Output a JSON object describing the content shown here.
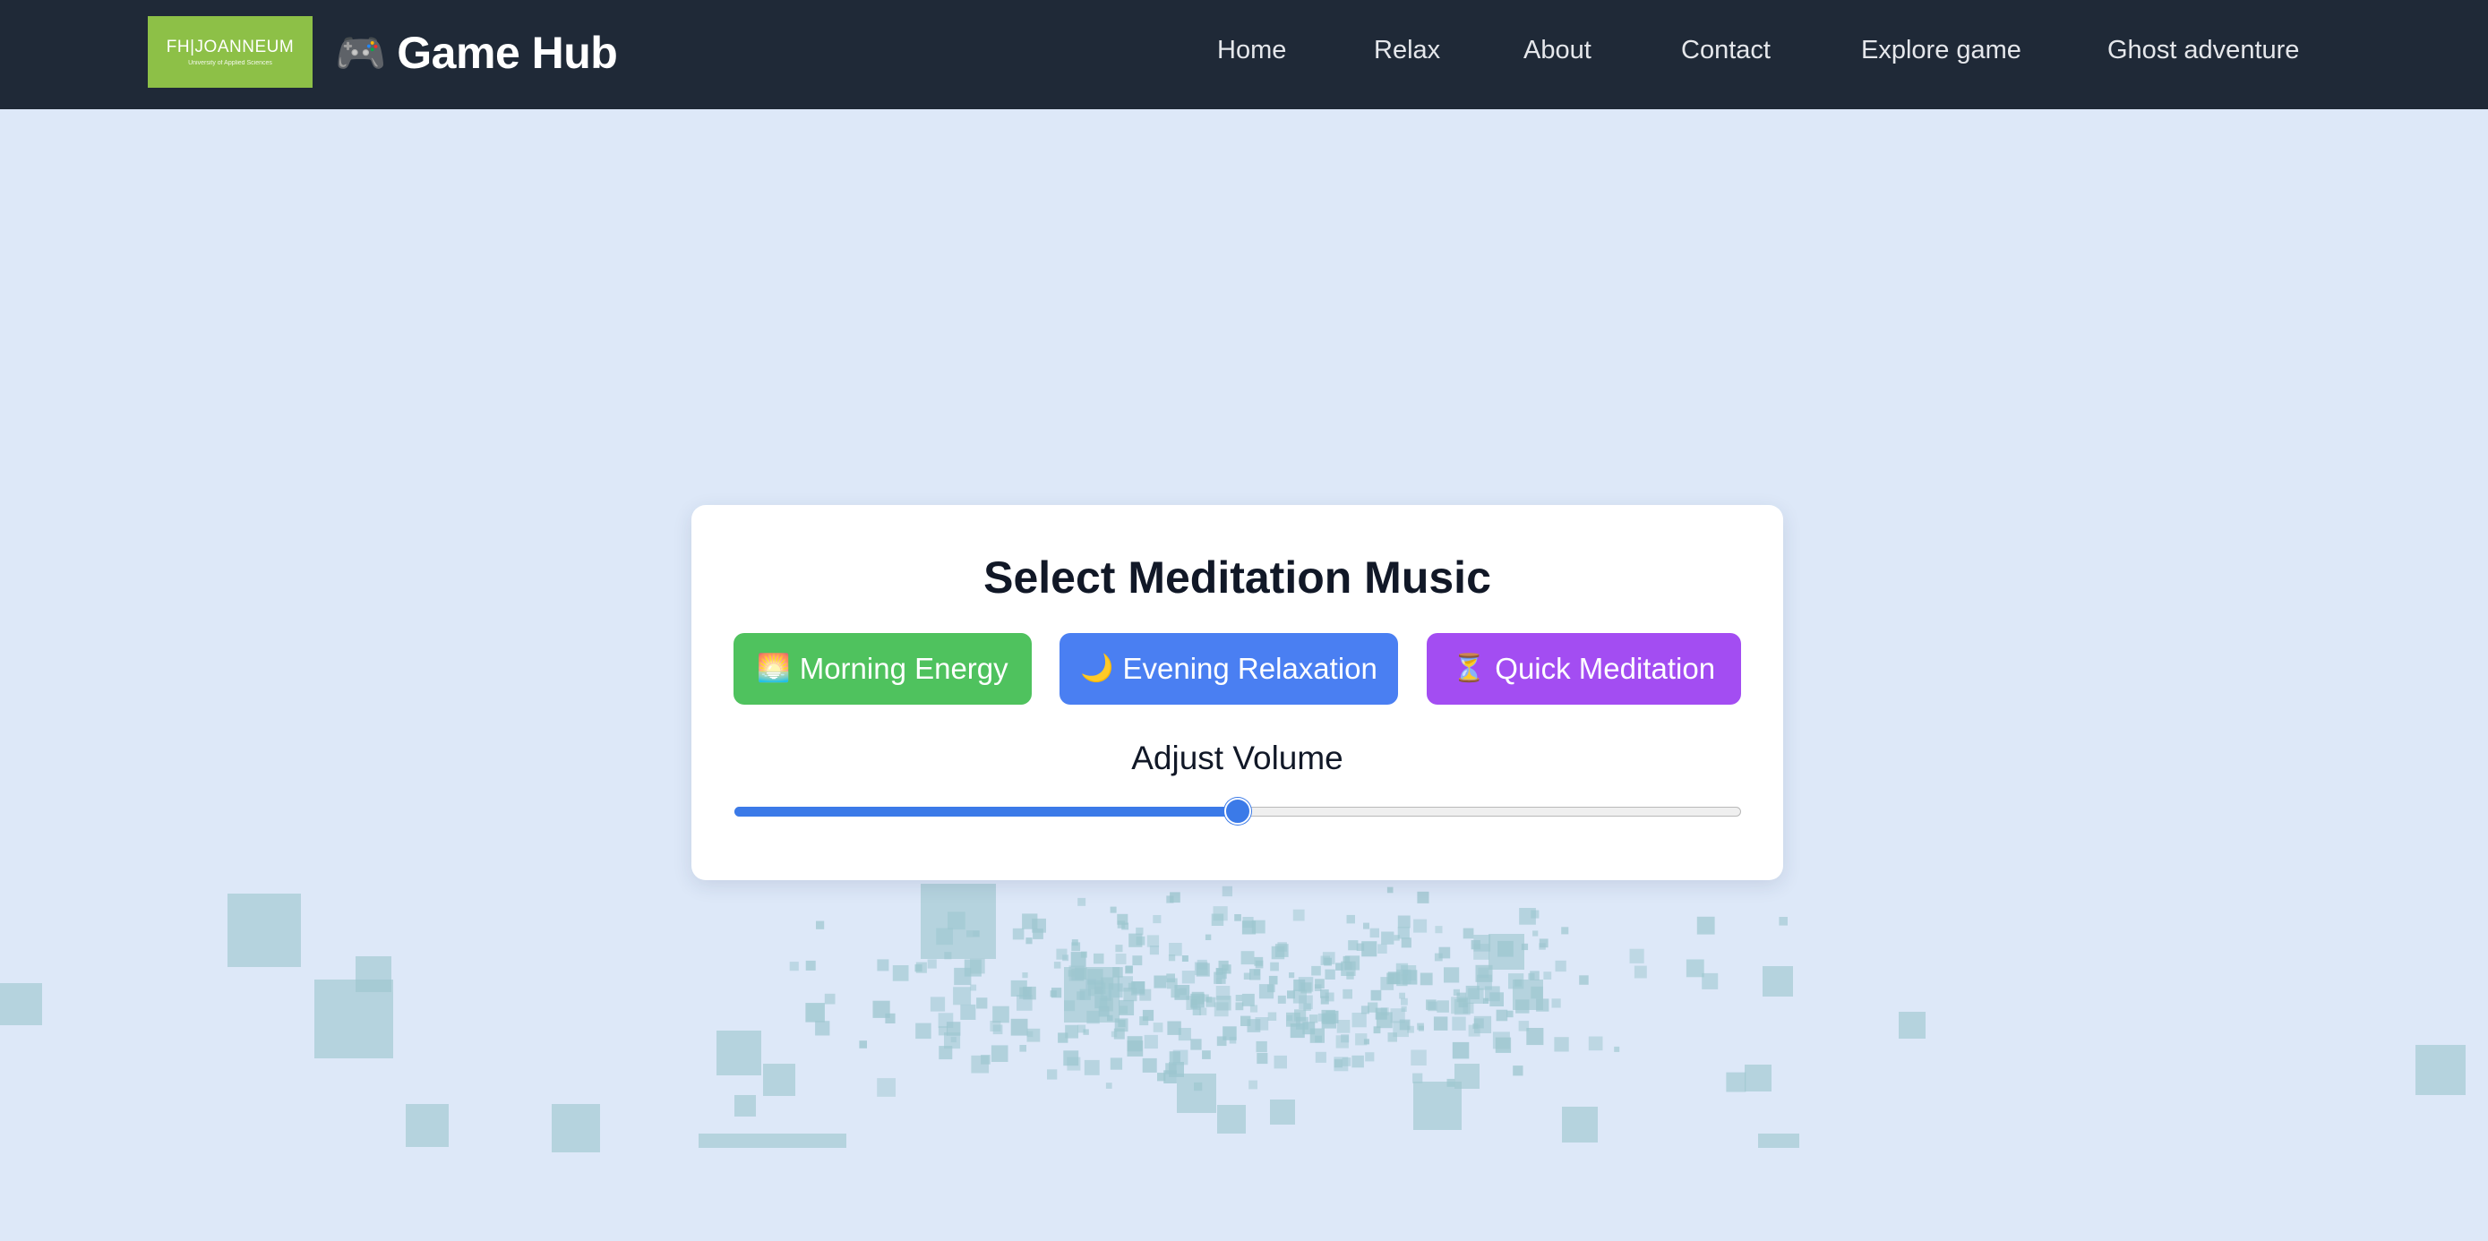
{
  "navbar": {
    "logo": {
      "main": "FH|JOANNEUM",
      "sub": "University of Applied Sciences"
    },
    "brand": {
      "icon": "🎮",
      "icon_name": "game-controller-icon",
      "title": "Game Hub"
    },
    "links": [
      "Home",
      "Relax",
      "About",
      "Contact",
      "Explore game",
      "Ghost adventure"
    ]
  },
  "card": {
    "title": "Select Meditation Music",
    "buttons": [
      {
        "icon": "🌅",
        "icon_name": "sunrise-icon",
        "label": "Morning Energy",
        "color": "#4fc25e"
      },
      {
        "icon": "🌙",
        "icon_name": "moon-icon",
        "label": "Evening Relaxation",
        "color": "#4a7ff2"
      },
      {
        "icon": "⏳",
        "icon_name": "hourglass-icon",
        "label": "Quick Meditation",
        "color": "#a34df2"
      }
    ],
    "volume_label": "Adjust Volume",
    "volume": 0.5
  },
  "colors": {
    "navbar_bg": "#1f2937",
    "page_bg": "#dde8f8",
    "logo_bg": "#8dc047",
    "accent": "#3b7ae8",
    "particle": "#9cc6cf"
  }
}
